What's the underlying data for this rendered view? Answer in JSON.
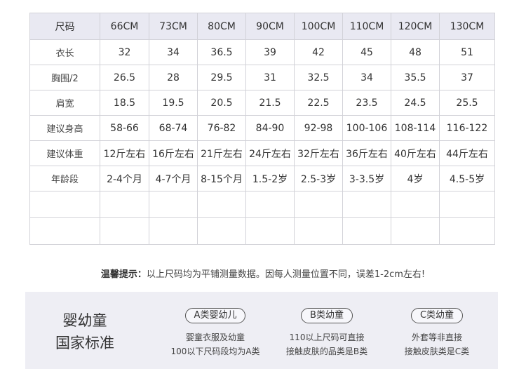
{
  "table": {
    "header": [
      "尺码",
      "66CM",
      "73CM",
      "80CM",
      "90CM",
      "100CM",
      "110CM",
      "120CM",
      "130CM"
    ],
    "rows": [
      [
        "衣长",
        "32",
        "34",
        "36.5",
        "39",
        "42",
        "45",
        "48",
        "51"
      ],
      [
        "胸围/2",
        "26.5",
        "28",
        "29.5",
        "31",
        "32.5",
        "34",
        "35.5",
        "37"
      ],
      [
        "肩宽",
        "18.5",
        "19.5",
        "20.5",
        "21.5",
        "22.5",
        "23.5",
        "24.5",
        "25.5"
      ],
      [
        "建议身高",
        "58-66",
        "68-74",
        "76-82",
        "84-90",
        "92-98",
        "100-106",
        "108-114",
        "116-122"
      ],
      [
        "建议体重",
        "12斤左右",
        "16斤左右",
        "21斤左右",
        "24斤左右",
        "32斤左右",
        "36斤左右",
        "40斤左右",
        "44斤左右"
      ],
      [
        "年龄段",
        "2-4个月",
        "4-7个月",
        "8-15个月",
        "1.5-2岁",
        "2.5-3岁",
        "3-3.5岁",
        "4岁",
        "4.5-5岁"
      ]
    ]
  },
  "notice": {
    "label": "温馨提示：",
    "text": "以上尺码均为平铺测量数据。因每人测量位置不同，误差1-2cm左右!"
  },
  "standard": {
    "title_line1": "婴幼童",
    "title_line2": "国家标准",
    "classes": [
      {
        "badge": "A类婴幼儿",
        "line1": "婴童衣服及幼童",
        "line2": "100以下尺码段均为A类"
      },
      {
        "badge": "B类幼童",
        "line1": "110以上尺码可直接",
        "line2": "接触皮肤的品类是B类"
      },
      {
        "badge": "C类幼童",
        "line1": "外套等非直接",
        "line2": "接触皮肤类是C类"
      }
    ]
  }
}
